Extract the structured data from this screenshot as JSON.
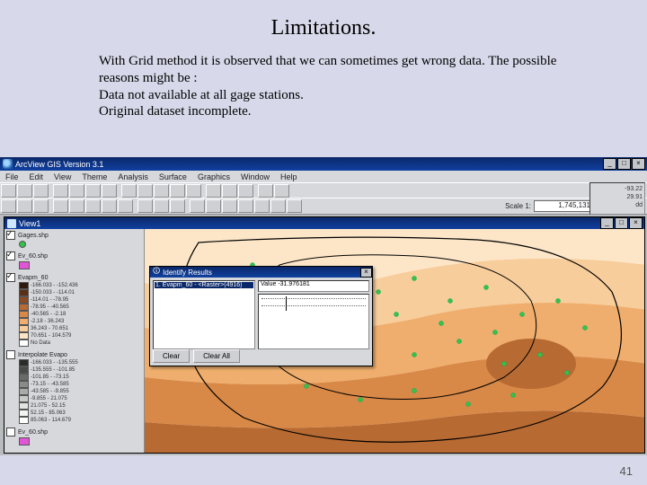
{
  "slide": {
    "title": "Limitations.",
    "paragraphs": [
      "With Grid method it is observed that we can sometimes get wrong data. The possible reasons might be :",
      "Data not available at all gage stations.",
      "Original dataset incomplete."
    ],
    "page_number": "41"
  },
  "app": {
    "title": "ArcView GIS Version 3.1",
    "menus": [
      "File",
      "Edit",
      "View",
      "Theme",
      "Analysis",
      "Surface",
      "Graphics",
      "Window",
      "Help"
    ],
    "toolbar_icons_row1": [
      "open",
      "save",
      "print",
      "cut",
      "copy",
      "paste",
      "undo",
      "add-theme",
      "theme-props",
      "table",
      "find",
      "query",
      "chart",
      "layout",
      "hammer",
      "help-pointer",
      "help"
    ],
    "toolbar_icons_row2": [
      "pointer",
      "identify",
      "pan",
      "zoom-in",
      "zoom-out",
      "zoom-full",
      "zoom-prev",
      "zoom-sel",
      "select",
      "select-rect",
      "clear-sel",
      "measure",
      "hotlink",
      "label",
      "text",
      "draw-point",
      "draw-line",
      "draw-poly"
    ],
    "scale_label": "Scale 1:",
    "scale_value": "1,745,131",
    "coords": {
      "x": "-93.22",
      "y": "29.91",
      "unit": "dd"
    }
  },
  "view": {
    "title": "View1",
    "layers": [
      {
        "name": "Gages.shp",
        "checked": true,
        "swatch": "#35c24a",
        "type": "point"
      },
      {
        "name": "Ev_60.shp",
        "checked": true,
        "swatch": "#e255d6",
        "type": "poly"
      },
      {
        "name": "Evapm_60",
        "checked": true,
        "type": "grid",
        "classes": [
          {
            "color": "#2e1a0e",
            "range": "-166.033 - -152.436"
          },
          {
            "color": "#5a2f16",
            "range": "-150.033 - -114.01"
          },
          {
            "color": "#8a4a22",
            "range": "-114.01 - -78.95"
          },
          {
            "color": "#b76a32",
            "range": "-78.95 - -40.565"
          },
          {
            "color": "#d98947",
            "range": "-40.565 - -2.18"
          },
          {
            "color": "#efae6d",
            "range": "-2.18 - 36.243"
          },
          {
            "color": "#f8cd9c",
            "range": "36.243 - 70.651"
          },
          {
            "color": "#fde6c8",
            "range": "70.651 - 104.579"
          },
          {
            "color": "#ffffff",
            "range": "No Data"
          }
        ]
      },
      {
        "name": "Interpolate Evapo",
        "checked": false,
        "type": "grid_gray",
        "classes": [
          {
            "color": "#2b2b2b",
            "range": "-166.033 - -135.555"
          },
          {
            "color": "#4a4a4a",
            "range": "-135.555 - -101.85"
          },
          {
            "color": "#6a6a6a",
            "range": "-101.85 - -73.15"
          },
          {
            "color": "#8a8a8a",
            "range": "-73.15 - -43.585"
          },
          {
            "color": "#aaaaaa",
            "range": "-43.585 - -9.855"
          },
          {
            "color": "#cacaca",
            "range": "-9.855 - 21.075"
          },
          {
            "color": "#e3e3e3",
            "range": "21.075 - 52.15"
          },
          {
            "color": "#f4f4f4",
            "range": "52.15 - 85.063"
          },
          {
            "color": "#ffffff",
            "range": "85.063 - 114.679"
          }
        ]
      },
      {
        "name": "Ev_60.shp",
        "checked": false,
        "swatch": "#e255d6",
        "type": "poly"
      }
    ]
  },
  "identify": {
    "title": "Identify Results",
    "selected_row": "1. Evapm_60 - <Raster>(4916)",
    "value_field": "Value   -31.976181",
    "clear_label": "Clear",
    "clear_all_label": "Clear All"
  },
  "colors": {
    "titlebar_top": "#0a2869",
    "titlebar_bottom": "#1040a0",
    "panel": "#d6d8dc"
  }
}
